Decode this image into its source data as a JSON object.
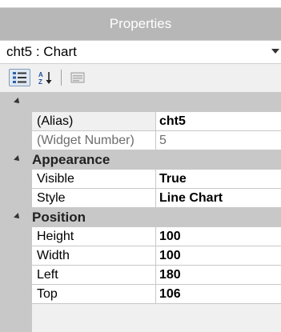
{
  "panel": {
    "title": "Properties"
  },
  "selector": {
    "value": "cht5 : Chart"
  },
  "toolbar": {
    "categorized_icon": "categorized-icon",
    "alphabetical_icon": "alphabetical-icon",
    "property_pages_icon": "property-pages-icon",
    "az_label": "A Z"
  },
  "grid": {
    "root_rows": [
      {
        "name": "(Alias)",
        "value": "cht5"
      },
      {
        "name": "(Widget Number)",
        "value": "5"
      }
    ],
    "categories": [
      {
        "label": "Appearance",
        "rows": [
          {
            "name": "Visible",
            "value": "True"
          },
          {
            "name": "Style",
            "value": "Line Chart"
          }
        ]
      },
      {
        "label": "Position",
        "rows": [
          {
            "name": "Height",
            "value": "100"
          },
          {
            "name": "Width",
            "value": "100"
          },
          {
            "name": "Left",
            "value": "180"
          },
          {
            "name": "Top",
            "value": "106"
          }
        ]
      }
    ]
  }
}
